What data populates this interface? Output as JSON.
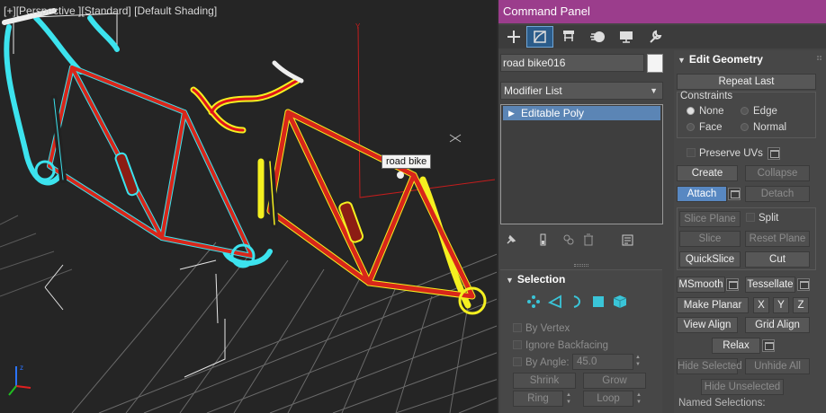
{
  "viewport": {
    "label_plus": "[+]",
    "label_view": "[Perspective ]",
    "label_std": "[Standard]",
    "label_shading": "[Default Shading]",
    "tooltip": "road bike"
  },
  "command_panel": {
    "title": "Command Panel",
    "tabs": [
      "create-icon",
      "modify-icon",
      "hierarchy-icon",
      "motion-icon",
      "display-icon",
      "utilities-icon"
    ],
    "active_tab": "modify-icon",
    "object_name": "road bike016",
    "object_color": "#f4f4f4",
    "modifier_list_label": "Modifier List",
    "stack_item": "Editable Poly"
  },
  "selection": {
    "title": "Selection",
    "by_vertex": "By Vertex",
    "ignore_backfacing": "Ignore Backfacing",
    "by_angle": "By Angle:",
    "angle_value": "45.0",
    "shrink": "Shrink",
    "grow": "Grow",
    "ring": "Ring",
    "loop": "Loop"
  },
  "edit_geometry": {
    "title": "Edit Geometry",
    "repeat_last": "Repeat Last",
    "constraints_label": "Constraints",
    "constraint_none": "None",
    "constraint_edge": "Edge",
    "constraint_face": "Face",
    "constraint_normal": "Normal",
    "preserve_uvs": "Preserve UVs",
    "create": "Create",
    "collapse": "Collapse",
    "attach": "Attach",
    "detach": "Detach",
    "slice_plane": "Slice Plane",
    "split": "Split",
    "slice": "Slice",
    "reset_plane": "Reset Plane",
    "quickslice": "QuickSlice",
    "cut": "Cut",
    "msmooth": "MSmooth",
    "tessellate": "Tessellate",
    "make_planar": "Make Planar",
    "x": "X",
    "y": "Y",
    "z": "Z",
    "view_align": "View Align",
    "grid_align": "Grid Align",
    "relax": "Relax",
    "hide_selected": "Hide Selected",
    "unhide_all": "Unhide All",
    "hide_unselected": "Hide Unselected",
    "named_selections": "Named Selections:"
  },
  "colors": {
    "title_bar": "#9b3d8c",
    "active_tab": "#2b5c8a",
    "highlight_blue": "#5888c2",
    "cyan_outline": "#3ce3ee",
    "yellow_outline": "#f4f020",
    "frame_red": "#d8261a"
  }
}
